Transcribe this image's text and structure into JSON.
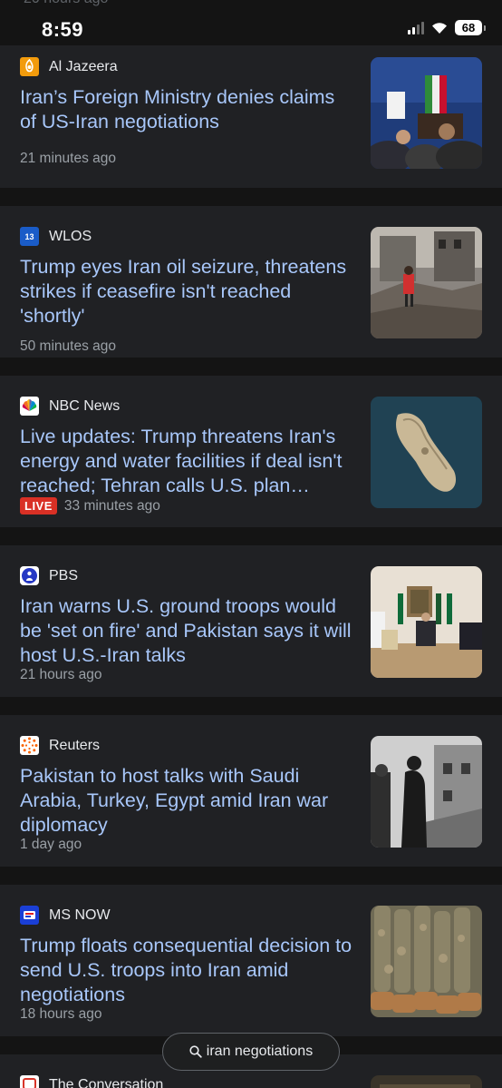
{
  "status_bar": {
    "clipped_text": "20 hours ago",
    "time": "8:59",
    "battery": "68"
  },
  "articles": [
    {
      "source": "Al Jazeera",
      "headline": "Iran’s Foreign Ministry denies claims of US-Iran negotiations",
      "time": "21 minutes ago",
      "logo_text": ""
    },
    {
      "source": "WLOS",
      "headline": "Trump eyes Iran oil seizure, threatens strikes if ceasefire isn't reached 'shortly'",
      "time": "50 minutes ago",
      "logo_text": "13"
    },
    {
      "source": "NBC News",
      "headline": "Live updates: Trump threatens Iran's energy and water facilities if deal isn't reached; Tehran calls U.S. plan…",
      "live_label": "LIVE",
      "time": "33 minutes ago",
      "logo_text": ""
    },
    {
      "source": "PBS",
      "headline": "Iran warns U.S. ground troops would be 'set on fire' and Pakistan says it will host U.S.-Iran talks",
      "time": "21 hours ago",
      "logo_text": ""
    },
    {
      "source": "Reuters",
      "headline": "Pakistan to host talks with Saudi Arabia, Turkey, Egypt amid Iran war diplomacy",
      "time": "1 day ago",
      "logo_text": ""
    },
    {
      "source": "MS NOW",
      "headline": "Trump floats consequential decision to send U.S. troops into Iran amid negotiations",
      "time": "18 hours ago",
      "logo_text": ""
    },
    {
      "source": "The Conversation",
      "headline": "",
      "time": "",
      "logo_text": ""
    }
  ],
  "search": {
    "query": "iran negotiations"
  },
  "colors": {
    "headline": "#a8c7fa",
    "card": "#202124",
    "background": "#141414",
    "live": "#d93025"
  }
}
